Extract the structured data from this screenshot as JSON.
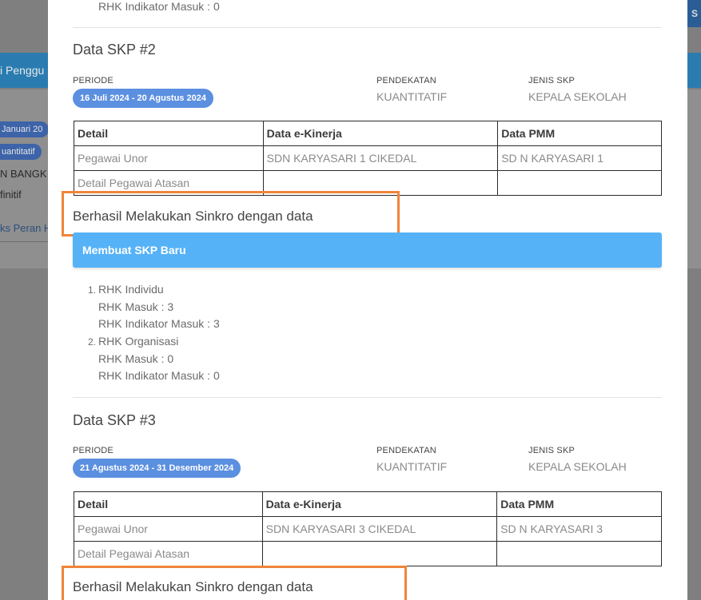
{
  "background": {
    "band_title": "i Penggu",
    "pill_date": "Januari 20",
    "pill_kuantitatif": "uantitatif",
    "text_bangk": "N BANGK",
    "text_finitif": "finitif",
    "link_peran": "ks Peran H",
    "right_button": "S"
  },
  "top_rhk": {
    "indikator": "RHK Indikator Masuk : 0"
  },
  "labels": {
    "periode": "PERIODE",
    "pendekatan": "PENDEKATAN",
    "jenis_skp": "JENIS SKP"
  },
  "table_headers": {
    "detail": "Detail",
    "ekinerja": "Data e-Kinerja",
    "pmm": "Data PMM"
  },
  "skp2": {
    "title": "Data SKP #2",
    "periode": "16 Juli 2024 - 20 Agustus 2024",
    "pendekatan": "KUANTITATIF",
    "jenis": "KEPALA SEKOLAH",
    "rows": [
      {
        "detail": "Pegawai Unor",
        "ekinerja": "SDN KARYASARI 1 CIKEDAL",
        "pmm": "SD N KARYASARI 1"
      },
      {
        "detail": "Detail Pegawai Atasan",
        "ekinerja": "",
        "pmm": ""
      }
    ],
    "success": "Berhasil Melakukan Sinkro dengan data",
    "new_skp": "Membuat SKP Baru",
    "rhk": [
      {
        "num": "1.",
        "name": "RHK Individu",
        "masuk": "RHK Masuk : 3",
        "indikator": "RHK Indikator Masuk : 3"
      },
      {
        "num": "2.",
        "name": "RHK Organisasi",
        "masuk": "RHK Masuk : 0",
        "indikator": "RHK Indikator Masuk : 0"
      }
    ]
  },
  "skp3": {
    "title": "Data SKP #3",
    "periode": "21 Agustus 2024 - 31 Desember 2024",
    "pendekatan": "KUANTITATIF",
    "jenis": "KEPALA SEKOLAH",
    "rows": [
      {
        "detail": "Pegawai Unor",
        "ekinerja": "SDN KARYASARI 3 CIKEDAL",
        "pmm": "SD N KARYASARI 3"
      },
      {
        "detail": "Detail Pegawai Atasan",
        "ekinerja": "",
        "pmm": ""
      }
    ],
    "success": "Berhasil Melakukan Sinkro dengan data"
  },
  "colors": {
    "highlight": "#f0843a",
    "new_skp_bar": "#55b2f7",
    "periode_pill": "#5b8fe0"
  }
}
